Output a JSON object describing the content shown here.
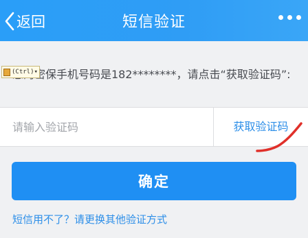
{
  "navbar": {
    "back_label": "返回",
    "title": "短信验证",
    "more_icon": "more-dots-icon",
    "color": "#2f9df5"
  },
  "ime_indicator": {
    "label": "(Ctrl)"
  },
  "info": {
    "text": "您的密保手机号码是182********，请点击“获取验证码”:"
  },
  "verification": {
    "placeholder": "请输入验证码",
    "value": "",
    "get_code_label": "获取验证码"
  },
  "confirm": {
    "label": "确定",
    "color": "#1f8ff3"
  },
  "alternative": {
    "link_text": "短信用不了？请更换其他验证方式"
  },
  "annotation": {
    "mark_color": "#e0302a"
  }
}
